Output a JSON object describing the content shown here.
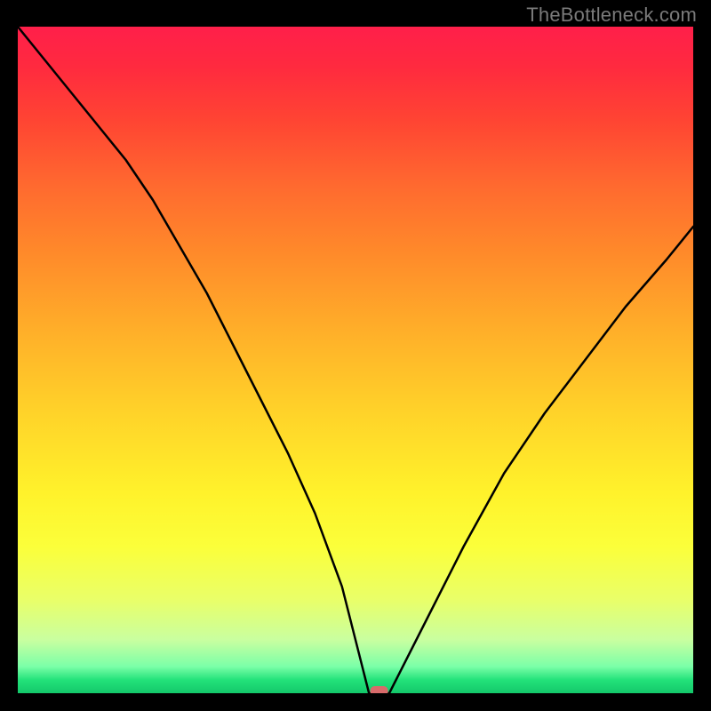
{
  "watermark": "TheBottleneck.com",
  "chart_data": {
    "type": "line",
    "title": "",
    "xlabel": "",
    "ylabel": "",
    "xlim": [
      0,
      100
    ],
    "ylim": [
      0,
      100
    ],
    "grid": false,
    "series": [
      {
        "name": "curve",
        "x": [
          0,
          4,
          8,
          12,
          16,
          20,
          24,
          28,
          32,
          36,
          40,
          44,
          48,
          51,
          52,
          55,
          56,
          60,
          66,
          72,
          78,
          84,
          90,
          96,
          100
        ],
        "values": [
          100,
          95,
          90,
          85,
          80,
          74,
          67,
          60,
          52,
          44,
          36,
          27,
          16,
          4,
          0,
          0,
          2,
          10,
          22,
          33,
          42,
          50,
          58,
          65,
          70
        ]
      }
    ],
    "marker": {
      "x": 53.5,
      "y": 0
    },
    "background": "heatmap-gradient-red-to-green"
  }
}
